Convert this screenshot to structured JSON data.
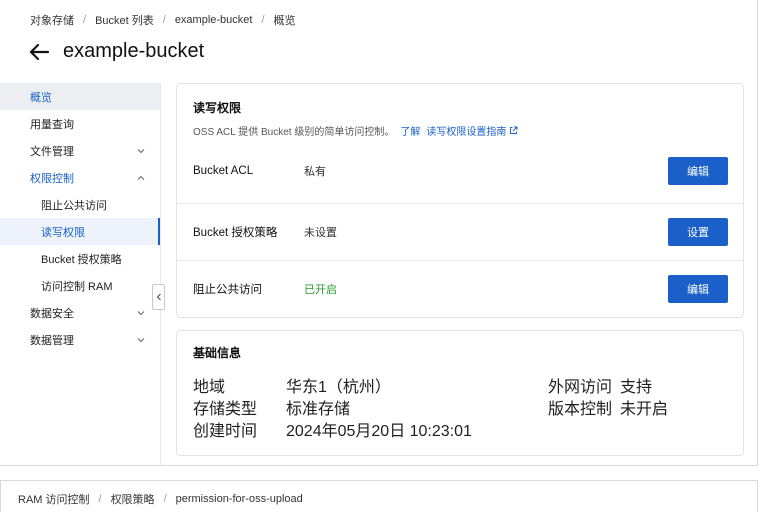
{
  "breadcrumb": [
    "对象存储",
    "Bucket 列表",
    "example-bucket",
    "概览"
  ],
  "page_title": "example-bucket",
  "sidebar": {
    "items": [
      {
        "label": "概览"
      },
      {
        "label": "用量查询"
      },
      {
        "label": "文件管理"
      },
      {
        "label": "权限控制"
      },
      {
        "label": "阻止公共访问"
      },
      {
        "label": "读写权限"
      },
      {
        "label": "Bucket 授权策略"
      },
      {
        "label": "访问控制 RAM"
      },
      {
        "label": "数据安全"
      },
      {
        "label": "数据管理"
      }
    ]
  },
  "acl_card": {
    "title": "读写权限",
    "description": "OSS ACL 提供 Bucket 级别的简单访问控制。",
    "link_learn": "了解",
    "link_guide": "读写权限设置指南",
    "rows": [
      {
        "label": "Bucket ACL",
        "value": "私有",
        "button": "编辑"
      },
      {
        "label": "Bucket 授权策略",
        "value": "未设置",
        "button": "设置"
      },
      {
        "label": "阻止公共访问",
        "value": "已开启",
        "button": "编辑"
      }
    ]
  },
  "info_card": {
    "title": "基础信息",
    "fields": [
      {
        "label": "地域",
        "value": "华东1（杭州）"
      },
      {
        "label": "存储类型",
        "value": "标准存储"
      },
      {
        "label": "创建时间",
        "value": "2024年05月20日 10:23:01"
      },
      {
        "label": "外网访问",
        "value": "支持"
      },
      {
        "label": "版本控制",
        "value": "未开启"
      }
    ]
  },
  "bottom_breadcrumb": [
    "RAM 访问控制",
    "权限策略",
    "permission-for-oss-upload"
  ],
  "colors": {
    "accent": "#1a60c8",
    "enabled": "#2a9a2a",
    "border": "#e3e3e3"
  }
}
